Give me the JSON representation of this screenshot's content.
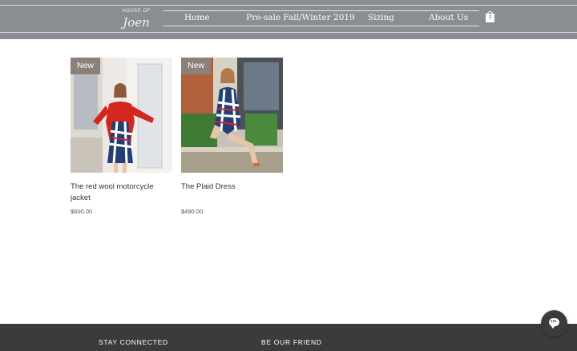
{
  "header": {
    "logo": {
      "top_text": "House of",
      "script_text": "Joen"
    },
    "nav": [
      {
        "label": "Home"
      },
      {
        "label": "Pre-sale Fall/Winter 2019"
      },
      {
        "label": "Sizing"
      },
      {
        "label": "About Us"
      }
    ],
    "cart": {
      "icon": "shopping-bag-icon",
      "count": "2"
    }
  },
  "products": [
    {
      "badge": "New",
      "name": "The red wool motorcycle jacket",
      "price": "$600.00"
    },
    {
      "badge": "New",
      "name": "The Plaid Dress",
      "price": "$490.00"
    }
  ],
  "footer": {
    "headings": [
      "STAY CONNECTED",
      "BE OUR FRIEND"
    ]
  },
  "chat": {
    "icon": "chat-bubble-icon"
  },
  "colors": {
    "header_bg": "#8a8d92",
    "badge_bg": "#8c817a",
    "footer_bg": "#3a3b3d"
  }
}
